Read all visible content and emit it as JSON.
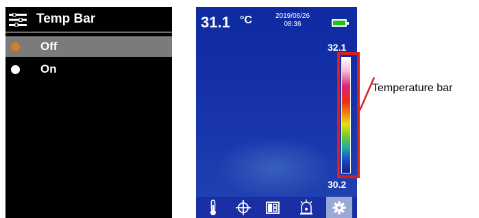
{
  "menu": {
    "title": "Temp Bar",
    "options": [
      {
        "label": "Off",
        "selected": true,
        "indicator_color": "#e07a1a"
      },
      {
        "label": "On",
        "selected": false,
        "indicator_color": "#ffffff"
      }
    ]
  },
  "screen": {
    "center_temp": "31.1",
    "temp_unit": "°C",
    "date": "2019/06/26",
    "time": "08:36",
    "battery_color": "#1ec21e",
    "scale_max": "32.1",
    "scale_min": "30.2",
    "toolbar_icons": [
      "thermometer-icon",
      "crosshair-icon",
      "palette-icon",
      "alarm-icon",
      "gear-icon"
    ],
    "active_tool": "gear-icon"
  },
  "annotation": {
    "label": "Temperature bar",
    "color": "#d62020"
  }
}
